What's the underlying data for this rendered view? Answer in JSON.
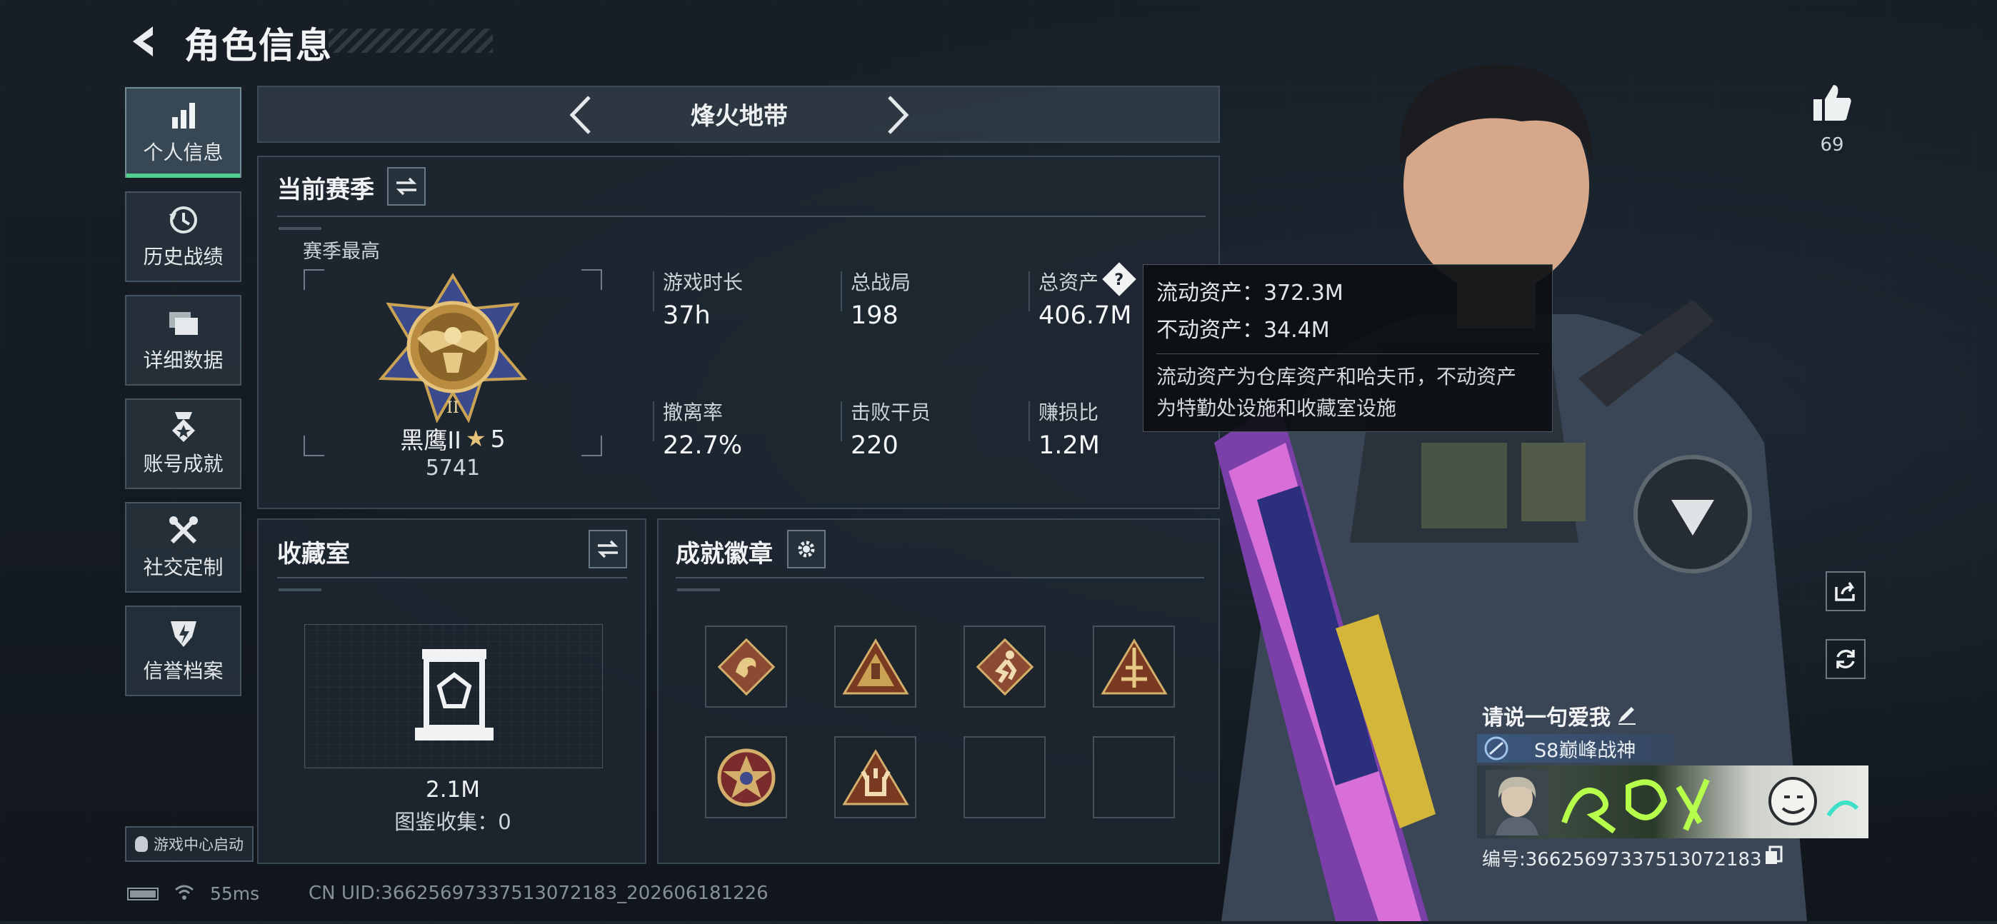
{
  "header": {
    "title": "角色信息"
  },
  "sidebar": {
    "items": [
      {
        "label": "个人信息",
        "icon": "bar-chart-icon",
        "active": true
      },
      {
        "label": "历史战绩",
        "icon": "history-clock-icon"
      },
      {
        "label": "详细数据",
        "icon": "folders-icon"
      },
      {
        "label": "账号成就",
        "icon": "achievement-medal-icon"
      },
      {
        "label": "社交定制",
        "icon": "tools-icon"
      },
      {
        "label": "信誉档案",
        "icon": "reputation-shield-icon"
      }
    ],
    "launch_label": "游戏中心启动"
  },
  "mode": {
    "label": "烽火地带"
  },
  "season": {
    "title": "当前赛季",
    "best_label": "赛季最高",
    "rank_name": "黑鹰II",
    "rank_stars": "5",
    "rank_score": "5741",
    "stats": [
      {
        "label": "游戏时长",
        "value": "37h"
      },
      {
        "label": "总战局",
        "value": "198"
      },
      {
        "label": "总资产",
        "value": "406.7M"
      },
      {
        "label": "撤离率",
        "value": "22.7%"
      },
      {
        "label": "击败干员",
        "value": "220"
      },
      {
        "label": "赚损比",
        "value": "1.2M"
      }
    ]
  },
  "tooltip": {
    "liquid": "流动资产：372.3M",
    "fixed": "不动资产：34.4M",
    "desc_line1": "流动资产为仓库资产和哈夫币，不动资产",
    "desc_line2": "为特勤处设施和收藏室设施"
  },
  "collection": {
    "title": "收藏室",
    "value": "2.1M",
    "count_label": "图鉴收集：0"
  },
  "badges": {
    "title": "成就徽章",
    "filled": 6,
    "total": 8
  },
  "profile": {
    "likes": "69",
    "motto": "请说一句爱我",
    "rank_title": "S8巅峰战神",
    "id_label": "编号:3662569733751307218​3"
  },
  "status": {
    "ping": "55ms",
    "uid": "CN UID:3662569733751307218​3_202606181226"
  },
  "colors": {
    "accent_green": "#4fd08f",
    "gold": "#c9a253",
    "panel_bg": "#1e2831"
  }
}
